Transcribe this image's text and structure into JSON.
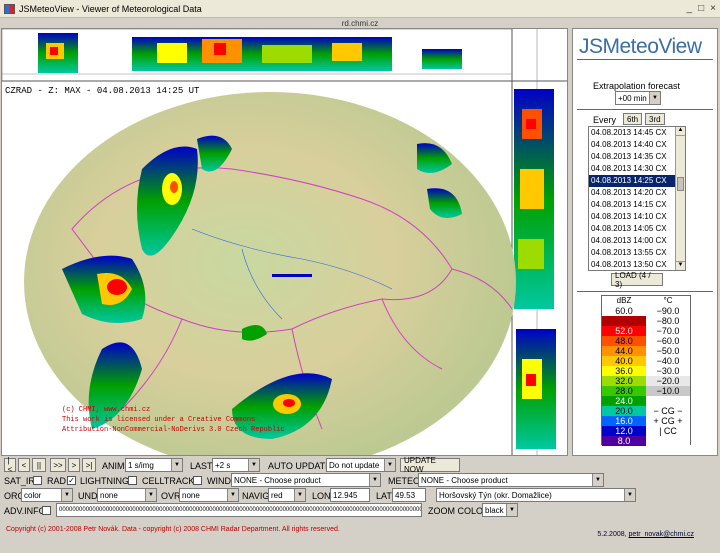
{
  "window": {
    "title": "JSMeteoView - Viewer of Meteorological Data",
    "controls": [
      "_",
      "□",
      "×"
    ]
  },
  "url": "rd.chmi.cz",
  "map": {
    "caption": "CZRAD - Z: MAX - 04.08.2013 14:25 UT",
    "copyright_lines": [
      "(c) CHMI, www.chmi.cz",
      "This work is licensed under a Creative Commons",
      "Attribution-NonCommercial-NoDerivs 3.0 Czech Republic"
    ]
  },
  "panel": {
    "logo": "JSMeteoView",
    "extrap_label": "Extrapolation forecast",
    "extrap_value": "+00 min",
    "every_label": "Every",
    "every_6th": "6th",
    "every_3rd": "3rd",
    "times": [
      "04.08.2013 14:45 CX",
      "04.08.2013 14:40 CX",
      "04.08.2013 14:35 CX",
      "04.08.2013 14:30 CX",
      "04.08.2013 14:25 CX",
      "04.08.2013 14:20 CX",
      "04.08.2013 14:15 CX",
      "04.08.2013 14:10 CX",
      "04.08.2013 14:05 CX",
      "04.08.2013 14:00 CX",
      "04.08.2013 13:55 CX",
      "04.08.2013 13:50 CX"
    ],
    "selected_index": 4,
    "load_label": "LOAD (4 / 3)"
  },
  "legend": {
    "dbz_header": "dBZ",
    "temp_header": "°C",
    "rows": [
      {
        "dbz": "60.0",
        "dbz_color": "#ffffff",
        "temp": "−90.0",
        "temp_color": "#ffffff"
      },
      {
        "dbz": "",
        "dbz_color": "#b00000",
        "temp": "−80.0",
        "temp_color": "#ffffff"
      },
      {
        "dbz": "52.0",
        "dbz_color": "#ff0000",
        "temp": "−70.0",
        "temp_color": "#ffffff"
      },
      {
        "dbz": "48.0",
        "dbz_color": "#ff5000",
        "temp": "−60.0",
        "temp_color": "#ffffff"
      },
      {
        "dbz": "44.0",
        "dbz_color": "#ff9000",
        "temp": "−50.0",
        "temp_color": "#ffffff"
      },
      {
        "dbz": "40.0",
        "dbz_color": "#ffc800",
        "temp": "−40.0",
        "temp_color": "#ffffff"
      },
      {
        "dbz": "36.0",
        "dbz_color": "#ffff00",
        "temp": "−30.0",
        "temp_color": "#ffffff"
      },
      {
        "dbz": "32.0",
        "dbz_color": "#9cdc00",
        "temp": "−20.0",
        "temp_color": "#e8e8e8"
      },
      {
        "dbz": "28.0",
        "dbz_color": "#38c800",
        "temp": "−10.0",
        "temp_color": "#c8c8c8"
      },
      {
        "dbz": "24.0",
        "dbz_color": "#00a000",
        "temp": "",
        "temp_color": "#ffffff"
      },
      {
        "dbz": "20.0",
        "dbz_color": "#00c8a0",
        "temp": "− CG −",
        "temp_color": "#ffffff"
      },
      {
        "dbz": "16.0",
        "dbz_color": "#0064ff",
        "temp": "+ CG +",
        "temp_color": "#ffffff"
      },
      {
        "dbz": "12.0",
        "dbz_color": "#0000c8",
        "temp": "| CC",
        "temp_color": "#ffffff"
      },
      {
        "dbz": "8.0",
        "dbz_color": "#5000a0",
        "temp": "",
        "temp_color": "#ffffff"
      }
    ]
  },
  "controls": {
    "nav_buttons": [
      "|<",
      "<",
      "||",
      ">>",
      ">",
      ">|"
    ],
    "anim_label": "ANIM",
    "anim_value": "1 s/img",
    "last_label": "LAST",
    "last_value": "+2 s",
    "auto_update_label": "AUTO UPDATE",
    "auto_update_value": "Do not update",
    "update_now": "UPDATE NOW",
    "sat_ir": "SAT_IR",
    "rad": "RAD",
    "lightning": "LIGHTNING",
    "celltrack": "CELLTRACK",
    "wind": "WIND",
    "wind_value": "NONE - Choose product",
    "meteo": "METEO",
    "meteo_value": "NONE - Choose product",
    "oro": "ORO",
    "oro_value": "color",
    "und": "UND",
    "und_value": "none",
    "ovr": "OVR",
    "ovr_value": "none",
    "navig": "NAVIG",
    "navig_value": "red",
    "lon": "LON",
    "lon_value": "12.945",
    "lat": "LAT",
    "lat_value": "49.53",
    "place": "Horšovský Týn (okr. Domažlice)",
    "adv_info": "ADV.INFO",
    "adv_value": "0000000000000000000000000000000000000000000000000000000000000000000000000000000000000000000000000000000000000000",
    "zoom_color": "ZOOM COLOR",
    "zoom_value": "black"
  },
  "footer": {
    "copyright": "Copyright (c) 2001-2008 Petr Novák. Data - copyright (c) 2008 CHMI Radar Department. All rights reserved.",
    "version": "5.2.2008,",
    "email": "petr_novak@chmi.cz"
  }
}
